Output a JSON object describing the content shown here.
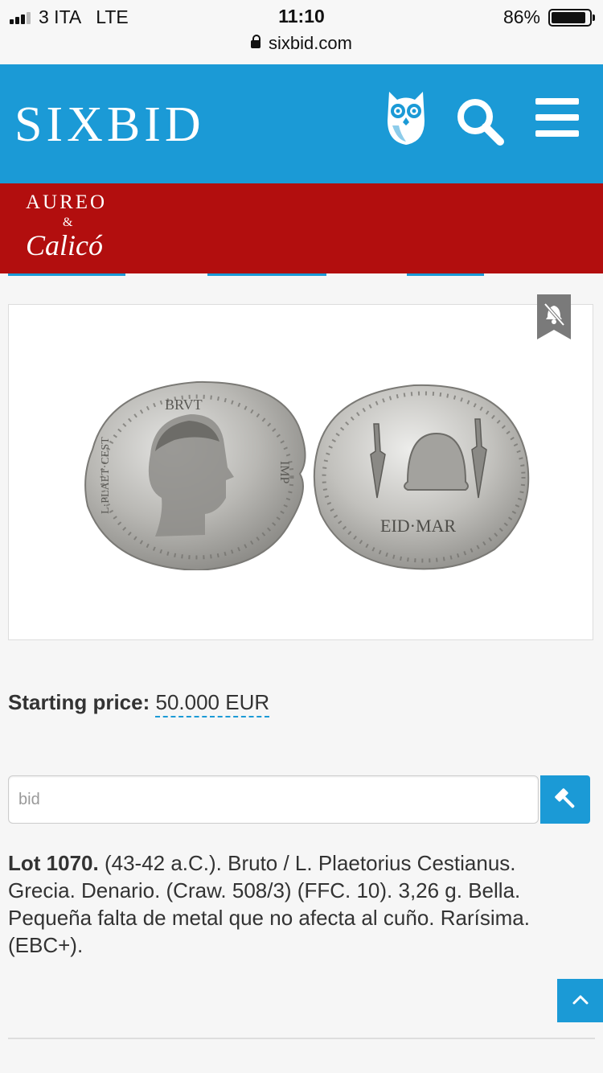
{
  "status_bar": {
    "carrier": "3 ITA",
    "network": "LTE",
    "time": "11:10",
    "url": "sixbid.com",
    "battery": "86%",
    "battery_level": 0.86
  },
  "header": {
    "logo": "SIXBID",
    "icons": [
      "owl-icon",
      "search-icon",
      "menu-icon"
    ],
    "color": "#1b9ad6"
  },
  "banner": {
    "line1": "AUREO",
    "amp": "&",
    "line2": "Calicó",
    "color": "#b20e0e"
  },
  "lot": {
    "price_label": "Starting price:",
    "price_value": "50.000 EUR",
    "bid_placeholder": "bid",
    "lot_label": "Lot 1070.",
    "description": "(43-42 a.C.). Bruto / L. Plaetorius Cestianus. Grecia. Denario. (Craw. 508/3) (FFC. 10). 3,26 g. Bella. Pequeña falta de metal que no afecta al cuño. Rarísima. (EBC+)."
  },
  "coin": {
    "obverse_legend_top": "BRVT",
    "obverse_legend_right": "IMP",
    "obverse_legend_left": "L·PLAET·CEST",
    "reverse_legend": "EID·MAR"
  }
}
